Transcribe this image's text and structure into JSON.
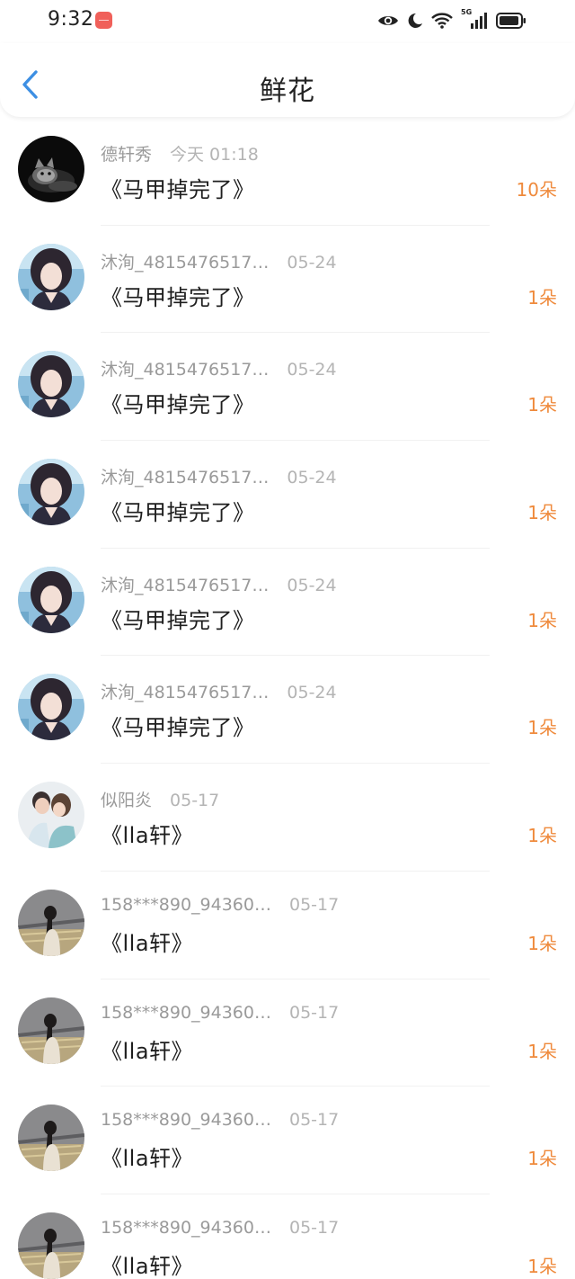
{
  "status_bar": {
    "time": "9:32",
    "network_label": "5G",
    "icons": [
      "app-badge",
      "eye-icon",
      "moon-icon",
      "wifi-icon",
      "signal-icon",
      "battery-icon"
    ]
  },
  "header": {
    "title": "鲜花",
    "back_icon": "chevron-left-icon"
  },
  "colors": {
    "accent_blue": "#3d8fe3",
    "count_orange": "#ef8a3c",
    "muted_text": "#9a9a9a"
  },
  "items": [
    {
      "name": "德轩秀",
      "time": "今天 01:18",
      "title": "《马甲掉完了》",
      "count": "10朵",
      "avatar": "black-cat"
    },
    {
      "name": "沐洵_4815476517…",
      "time": "05-24",
      "title": "《马甲掉完了》",
      "count": "1朵",
      "avatar": "girl-blue"
    },
    {
      "name": "沐洵_4815476517…",
      "time": "05-24",
      "title": "《马甲掉完了》",
      "count": "1朵",
      "avatar": "girl-blue"
    },
    {
      "name": "沐洵_4815476517…",
      "time": "05-24",
      "title": "《马甲掉完了》",
      "count": "1朵",
      "avatar": "girl-blue"
    },
    {
      "name": "沐洵_4815476517…",
      "time": "05-24",
      "title": "《马甲掉完了》",
      "count": "1朵",
      "avatar": "girl-blue"
    },
    {
      "name": "沐洵_4815476517…",
      "time": "05-24",
      "title": "《马甲掉完了》",
      "count": "1朵",
      "avatar": "girl-blue"
    },
    {
      "name": "似阳炎",
      "time": "05-17",
      "title": "《lla轩》",
      "count": "1朵",
      "avatar": "couple"
    },
    {
      "name": "158***890_94360…",
      "time": "05-17",
      "title": "《lla轩》",
      "count": "1朵",
      "avatar": "girl-back"
    },
    {
      "name": "158***890_94360…",
      "time": "05-17",
      "title": "《lla轩》",
      "count": "1朵",
      "avatar": "girl-back"
    },
    {
      "name": "158***890_94360…",
      "time": "05-17",
      "title": "《lla轩》",
      "count": "1朵",
      "avatar": "girl-back"
    },
    {
      "name": "158***890_94360…",
      "time": "05-17",
      "title": "《lla轩》",
      "count": "1朵",
      "avatar": "girl-back"
    }
  ]
}
